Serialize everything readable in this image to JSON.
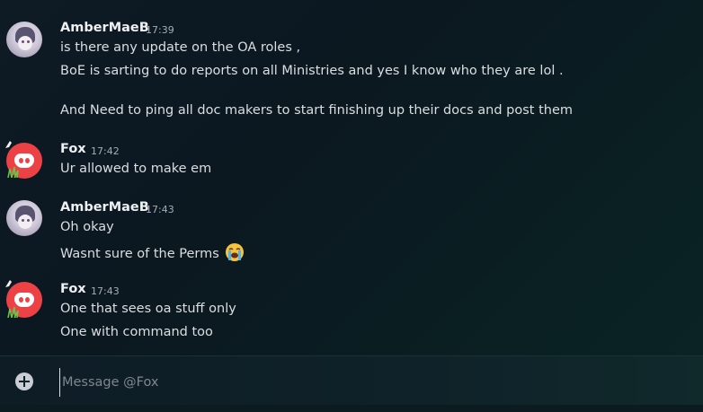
{
  "messages": [
    {
      "author": "AmberMaeB",
      "time": "17:39",
      "avatar": "anime-avatar",
      "lines": [
        "is there any update on the OA roles ,",
        "BoE is sarting to do reports on all Ministries and yes I know who they are lol .",
        "And Need to ping all doc makers to start finishing up their docs and post them"
      ]
    },
    {
      "author": "Fox",
      "time": "17:42",
      "avatar": "discord-logo-avatar",
      "lines": [
        "Ur allowed to make em"
      ]
    },
    {
      "author": "AmberMaeB",
      "time": "17:43",
      "avatar": "anime-avatar",
      "lines": [
        "Oh okay",
        "Wasnt sure of the Perms"
      ],
      "emoji": "loudly-crying-face"
    },
    {
      "author": "Fox",
      "time": "17:43",
      "avatar": "discord-logo-avatar",
      "lines": [
        "One that sees oa stuff only",
        "One with command too"
      ]
    }
  ],
  "composer": {
    "placeholder": "Message @Fox",
    "add_icon": "plus-circle-icon"
  },
  "colors": {
    "fox_avatar": "#ed4245",
    "background": "#0e1a24"
  }
}
